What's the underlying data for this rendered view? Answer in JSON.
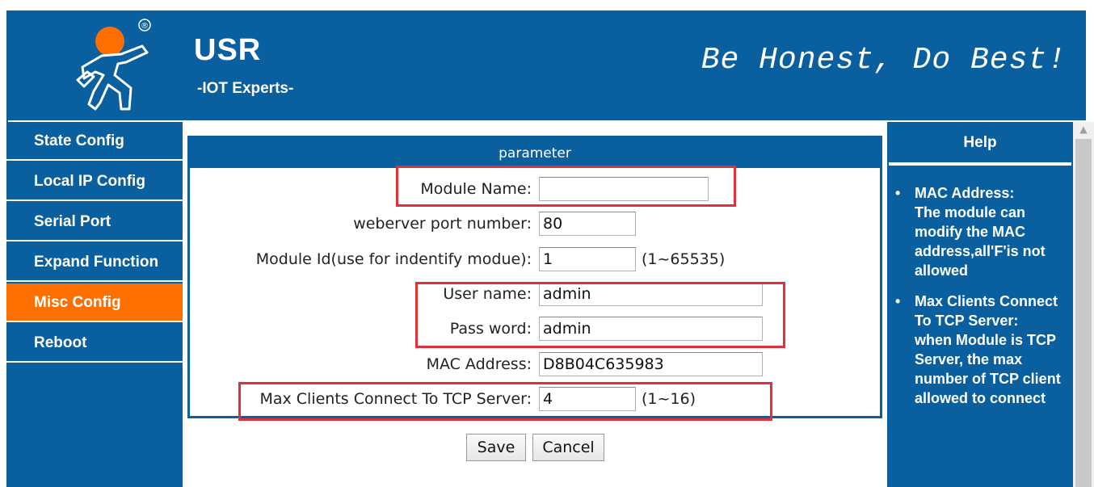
{
  "header": {
    "brand": "USR",
    "brand_sub": "-IOT Experts-",
    "slogan": "Be Honest, Do Best!",
    "registered_mark": "®"
  },
  "sidebar": {
    "items": [
      {
        "label": "State Config"
      },
      {
        "label": "Local IP Config"
      },
      {
        "label": "Serial Port"
      },
      {
        "label": "Expand Function"
      },
      {
        "label": "Misc Config",
        "active": true
      },
      {
        "label": "Reboot"
      }
    ]
  },
  "main": {
    "title": "parameter",
    "fields": {
      "module_name": {
        "label": "Module Name:",
        "value": ""
      },
      "web_port": {
        "label": "weberver port number:",
        "value": "80"
      },
      "module_id": {
        "label": "Module Id(use for indentify modue):",
        "value": "1",
        "hint": "(1~65535)"
      },
      "user_name": {
        "label": "User name:",
        "value": "admin"
      },
      "password": {
        "label": "Pass word:",
        "value": "admin"
      },
      "mac": {
        "label": "MAC Address:",
        "value": "D8B04C635983"
      },
      "max_clients": {
        "label": "Max Clients Connect To TCP Server:",
        "value": "4",
        "hint": "(1~16)"
      }
    },
    "save_label": "Save",
    "cancel_label": "Cancel"
  },
  "help": {
    "title": "Help",
    "items": [
      {
        "head": "MAC Address:",
        "text": "The module can modify the MAC address,all'F'is not allowed"
      },
      {
        "head": "Max Clients Connect To TCP Server:",
        "text": "when Module is TCP Server, the max number of TCP client allowed to connect"
      }
    ]
  },
  "colors": {
    "primary": "#0a5f9f",
    "active": "#ff6f00",
    "highlight": "#e0313b"
  }
}
